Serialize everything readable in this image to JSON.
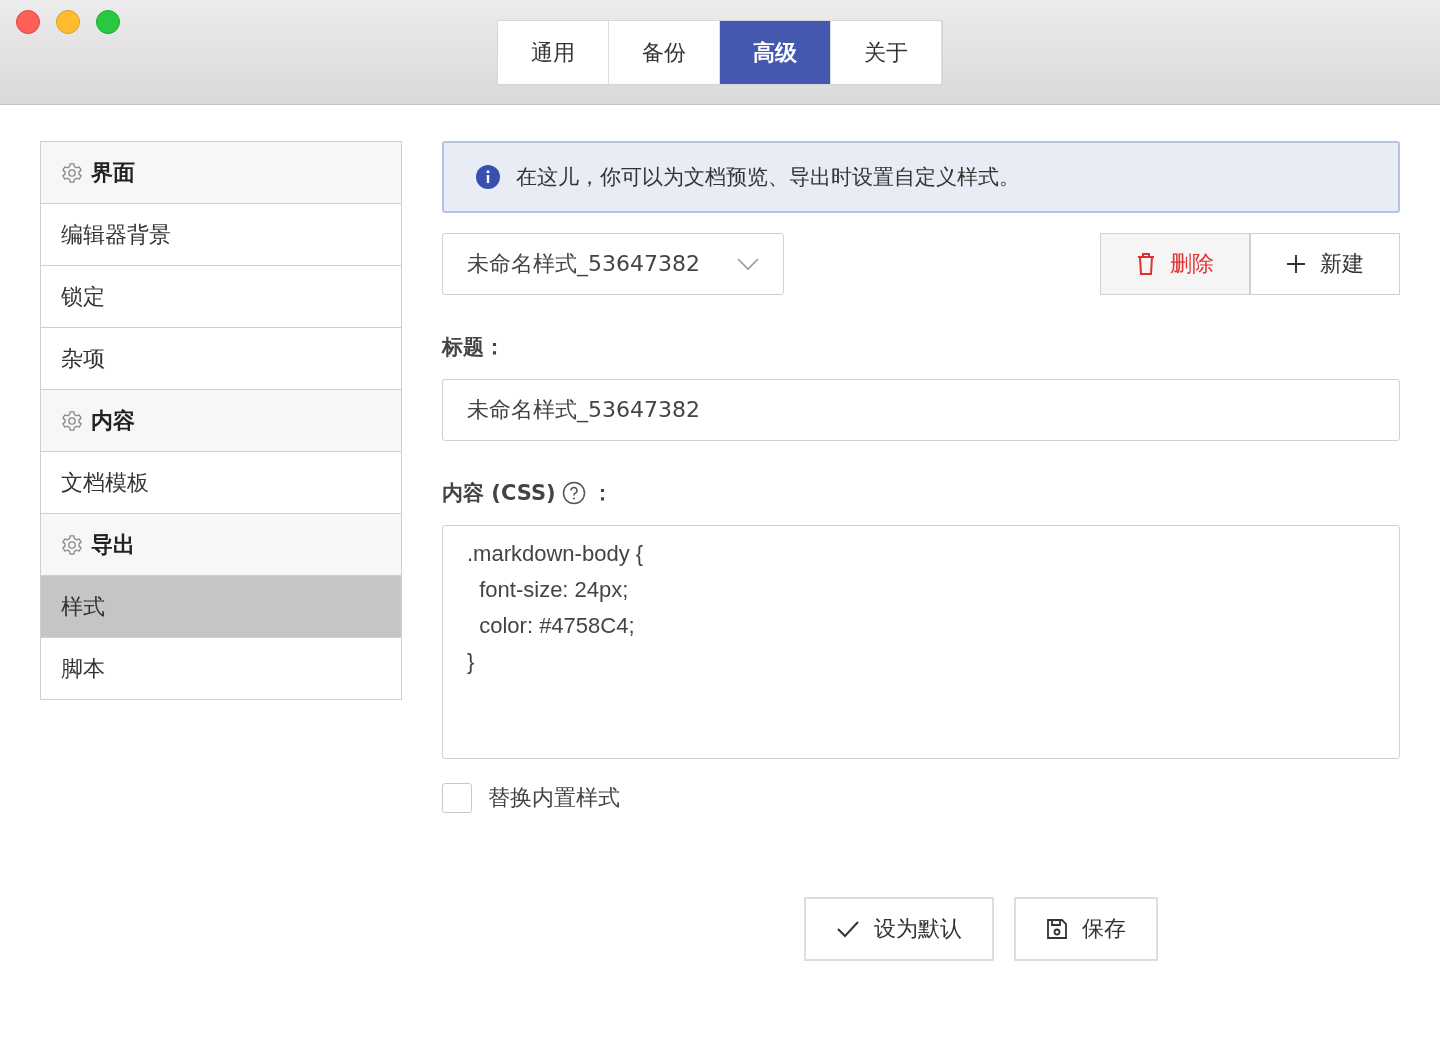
{
  "window": {
    "controls": [
      {
        "kind": "close"
      },
      {
        "kind": "minimize"
      },
      {
        "kind": "zoom"
      }
    ]
  },
  "tabs": [
    {
      "label": "通用",
      "selected": false
    },
    {
      "label": "备份",
      "selected": false
    },
    {
      "label": "高级",
      "selected": true
    },
    {
      "label": "关于",
      "selected": false
    }
  ],
  "sidebar": {
    "items": [
      {
        "kind": "header",
        "label": "界面",
        "selected": false
      },
      {
        "kind": "item",
        "label": "编辑器背景",
        "selected": false
      },
      {
        "kind": "item",
        "label": "锁定",
        "selected": false
      },
      {
        "kind": "item",
        "label": "杂项",
        "selected": false
      },
      {
        "kind": "header",
        "label": "内容",
        "selected": false
      },
      {
        "kind": "item",
        "label": "文档模板",
        "selected": false
      },
      {
        "kind": "header",
        "label": "导出",
        "selected": false
      },
      {
        "kind": "item",
        "label": "样式",
        "selected": true
      },
      {
        "kind": "item",
        "label": "脚本",
        "selected": false
      }
    ]
  },
  "info": {
    "text": "在这儿，你可以为文档预览、导出时设置自定义样式。"
  },
  "style_select": {
    "value": "未命名样式_53647382"
  },
  "buttons": [
    {
      "kind": "delete",
      "label": "删除"
    },
    {
      "kind": "new",
      "label": "新建"
    }
  ],
  "title_field": {
    "label": "标题：",
    "value": "未命名样式_53647382"
  },
  "content_field": {
    "label": "内容 (CSS)",
    "suffix": "：",
    "value": ".markdown-body {\n  font-size: 24px;\n  color: #4758C4;\n}"
  },
  "replace_builtin": {
    "label": "替换内置样式",
    "checked": false
  },
  "footer_buttons": [
    {
      "kind": "default",
      "label": "设为默认"
    },
    {
      "kind": "save",
      "label": "保存"
    }
  ]
}
